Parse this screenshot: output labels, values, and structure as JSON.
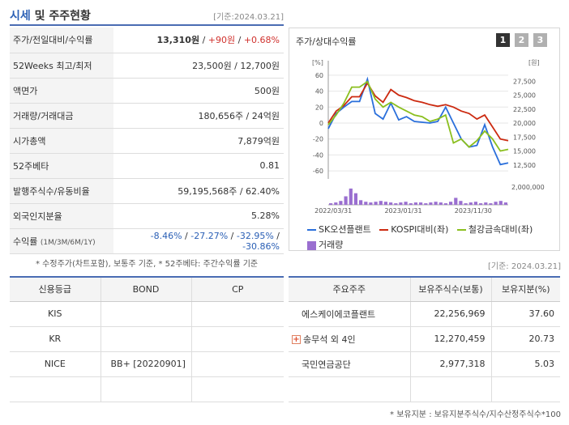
{
  "header": {
    "title_main": "시세",
    "title_rest": " 및 주주현황",
    "date": "[기준:2024.03.21]"
  },
  "quote": {
    "price_label": "주가/전일대비/수익률",
    "price": "13,310원",
    "change": "+90원",
    "change_pct": "+0.68%",
    "sep": " / ",
    "w52_label": "52Weeks 최고/최저",
    "w52_value": "23,500원 / 12,700원",
    "par_label": "액면가",
    "par_value": "500원",
    "volume_label": "거래량/거래대금",
    "volume_value": "180,656주 / 24억원",
    "mcap_label": "시가총액",
    "mcap_value": "7,879억원",
    "beta_label": "52주베타",
    "beta_value": "0.81",
    "shares_label": "발행주식수/유동비율",
    "shares_value": "59,195,568주 / 62.40%",
    "foreign_label": "외국인지분율",
    "foreign_value": "5.28%",
    "return_label": "수익률",
    "return_sub": "(1M/3M/6M/1Y)",
    "return_1m": "-8.46%",
    "return_3m": "-27.27%",
    "return_6m": "-32.95%",
    "return_1y": "-30.86%",
    "note": "* 수정주가(차트포함), 보통주 기준, * 52주베타: 주간수익률 기준"
  },
  "chart_panel": {
    "title": "주가/상대수익률",
    "pages": [
      "1",
      "2",
      "3"
    ],
    "active_color": "#333333",
    "inactive_color": "#b0b0b0"
  },
  "chart_data": {
    "type": "line",
    "left_unit": "[%]",
    "right_unit": "[원]",
    "left_ticks": [
      60,
      40,
      20,
      0,
      -20,
      -40,
      -60
    ],
    "left_ylim": [
      -70,
      70
    ],
    "right_ticks": [
      "27,500",
      "25,000",
      "22,500",
      "20,000",
      "17,500",
      "15,000",
      "12,500"
    ],
    "right_ylim": [
      10000,
      30000
    ],
    "volume_tick": "2,000,000",
    "x_ticks": [
      "2022/03/31",
      "2023/01/31",
      "2023/11/30"
    ],
    "x_tick_index": [
      1,
      15,
      29
    ],
    "series": [
      {
        "name": "SK오션플랜트",
        "color": "#2a6fdb",
        "values": [
          -7,
          12,
          20,
          27,
          27,
          55,
          12,
          5,
          25,
          4,
          8,
          2,
          1,
          0,
          2,
          20,
          0,
          -20,
          -30,
          -28,
          -2,
          -30,
          -52,
          -50
        ]
      },
      {
        "name": "KOSPI대비(좌)",
        "color": "#cc2a10",
        "values": [
          0,
          15,
          22,
          33,
          33,
          50,
          34,
          26,
          42,
          35,
          32,
          28,
          26,
          23,
          21,
          23,
          20,
          15,
          12,
          5,
          10,
          -5,
          -20,
          -22
        ]
      },
      {
        "name": "철강금속대비(좌)",
        "color": "#8bbf1f",
        "values": [
          -2,
          10,
          25,
          45,
          45,
          52,
          30,
          20,
          26,
          20,
          15,
          10,
          8,
          2,
          5,
          10,
          -25,
          -20,
          -30,
          -22,
          -10,
          -20,
          -35,
          -33
        ]
      }
    ],
    "volume": {
      "name": "거래량",
      "color": "#9a6fd0",
      "values": [
        0.2,
        0.3,
        0.5,
        1.1,
        2.1,
        1.5,
        0.6,
        0.4,
        0.3,
        0.4,
        0.5,
        0.4,
        0.3,
        0.2,
        0.3,
        0.4,
        0.2,
        0.3,
        0.3,
        0.2,
        0.3,
        0.4,
        0.3,
        0.2,
        0.4,
        0.9,
        0.5,
        0.2,
        0.3,
        0.4,
        0.2,
        0.3,
        0.2,
        0.4,
        0.5,
        0.3
      ],
      "max": 2.3
    }
  },
  "date2": "[기준: 2024.03.21]",
  "credit": {
    "headers": [
      "신용등급",
      "BOND",
      "CP"
    ],
    "rows": [
      [
        "KIS",
        "",
        ""
      ],
      [
        "KR",
        "",
        ""
      ],
      [
        "NICE",
        "BB+  [20220901]",
        ""
      ],
      [
        "",
        "",
        ""
      ]
    ]
  },
  "holders": {
    "headers": [
      "주요주주",
      "보유주식수(보통)",
      "보유지분(%)"
    ],
    "rows": [
      {
        "name": "에스케이에코플랜트",
        "shares": "22,256,969",
        "pct": "37.60",
        "expand": ""
      },
      {
        "name": "송무석 외 4인",
        "shares": "12,270,459",
        "pct": "20.73",
        "expand": "+"
      },
      {
        "name": "국민연금공단",
        "shares": "2,977,318",
        "pct": "5.03",
        "expand": ""
      },
      {
        "name": "",
        "shares": "",
        "pct": "",
        "expand": ""
      }
    ],
    "note": "* 보유지분 : 보유지분주식수/지수산정주식수*100"
  }
}
